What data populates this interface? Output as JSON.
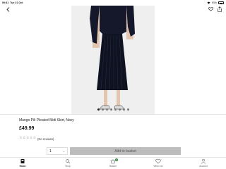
{
  "status_bar": {
    "time": "09:31",
    "date": "Tue 21 Oct",
    "battery": "93%"
  },
  "product": {
    "title": "Mango Pili Pleated Midi Skirt, Navy",
    "price": "£49.99",
    "reviews_text": "(No reviews)",
    "rating": 0,
    "rating_max": 5
  },
  "image_carousel": {
    "count": 8,
    "active_index": 0
  },
  "purchase": {
    "quantity": "1",
    "add_label": "Add to basket"
  },
  "tabs": [
    {
      "label": "Home",
      "icon": "home-icon",
      "active": true
    },
    {
      "label": "Shop",
      "icon": "search-icon",
      "active": false
    },
    {
      "label": "Basket",
      "icon": "basket-icon",
      "active": false,
      "badge": "0"
    },
    {
      "label": "Wish List",
      "icon": "heart-icon",
      "active": false
    },
    {
      "label": "Account",
      "icon": "account-icon",
      "active": false
    }
  ]
}
